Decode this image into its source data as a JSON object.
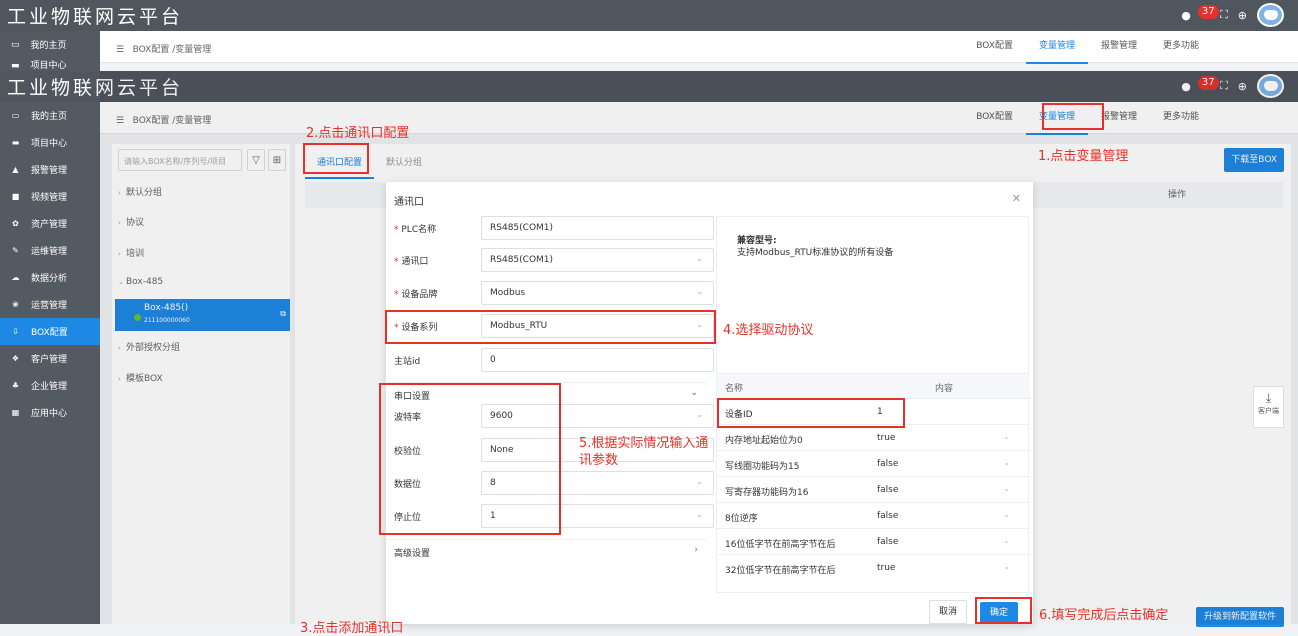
{
  "app": {
    "title": "工业物联网云平台",
    "notification_count": "37"
  },
  "breadcrumb": "BOX配置 /变量管理",
  "nav_tabs": [
    "BOX配置",
    "变量管理",
    "报警管理",
    "更多功能"
  ],
  "sidebar": [
    {
      "icon": "monitor-icon",
      "glyph": "▭",
      "label": "我的主页"
    },
    {
      "icon": "project-icon",
      "glyph": "▬",
      "label": "项目中心"
    },
    {
      "icon": "bell-icon",
      "glyph": "▲",
      "label": "报警管理"
    },
    {
      "icon": "video-icon",
      "glyph": "■",
      "label": "视频管理"
    },
    {
      "icon": "asset-icon",
      "glyph": "✿",
      "label": "资产管理"
    },
    {
      "icon": "wrench-icon",
      "glyph": "✎",
      "label": "运维管理"
    },
    {
      "icon": "cloud-icon",
      "glyph": "☁",
      "label": "数据分析"
    },
    {
      "icon": "ops-icon",
      "glyph": "❀",
      "label": "运营管理"
    },
    {
      "icon": "box-config-icon",
      "glyph": "⇩",
      "label": "BOX配置"
    },
    {
      "icon": "customer-icon",
      "glyph": "❖",
      "label": "客户管理"
    },
    {
      "icon": "org-icon",
      "glyph": "♣",
      "label": "企业管理"
    },
    {
      "icon": "app-icon",
      "glyph": "▦",
      "label": "应用中心"
    }
  ],
  "sidebar_partial_label": "项目中心",
  "left_panel": {
    "search_placeholder": "请输入BOX名称/序列号/项目",
    "groups": [
      "默认分组",
      "协议",
      "培训",
      "Box-485",
      "外部授权分组",
      "模板BOX"
    ],
    "selected_box": {
      "name": "Box-485()",
      "serial": "211100000060"
    }
  },
  "sub_tabs": [
    "通讯口配置",
    "默认分组"
  ],
  "download_button": "下载至BOX",
  "table_header_action": "操作",
  "upgrade_button": "升级到新配置软件",
  "dialog": {
    "title": "通讯口",
    "fields": {
      "plc_name_label": "PLC名称",
      "plc_name_value": "RS485(COM1)",
      "port_label": "通讯口",
      "port_value": "RS485(COM1)",
      "brand_label": "设备品牌",
      "brand_value": "Modbus",
      "series_label": "设备系列",
      "series_value": "Modbus_RTU",
      "station_label": "主站id",
      "station_value": "0"
    },
    "serial_section": "串口设置",
    "serial": {
      "baud_label": "波特率",
      "baud_value": "9600",
      "parity_label": "校验位",
      "parity_value": "None",
      "databits_label": "数据位",
      "databits_value": "8",
      "stopbits_label": "停止位",
      "stopbits_value": "1"
    },
    "advanced_section": "高级设置",
    "compat_title": "兼容型号:",
    "compat_desc": "支持Modbus_RTU标准协议的所有设备",
    "param_table": {
      "header_name": "名称",
      "header_content": "内容",
      "rows": [
        {
          "name": "设备ID",
          "value": "1",
          "dropdown": false
        },
        {
          "name": "内存地址起始位为0",
          "value": "true",
          "dropdown": true
        },
        {
          "name": "写线圈功能码为15",
          "value": "false",
          "dropdown": true
        },
        {
          "name": "写寄存器功能码为16",
          "value": "false",
          "dropdown": true
        },
        {
          "name": "8位逆序",
          "value": "false",
          "dropdown": true
        },
        {
          "name": "16位低字节在前高字节在后",
          "value": "false",
          "dropdown": true
        },
        {
          "name": "32位低字节在前高字节在后",
          "value": "true",
          "dropdown": true
        }
      ]
    },
    "cancel_button": "取消",
    "ok_button": "确定"
  },
  "float_button": "客户端",
  "annotations": {
    "step1": "1.点击变量管理",
    "step2": "2.点击通讯口配置",
    "step3": "3.点击添加通讯口",
    "step4": "4.选择驱动协议",
    "step5": "5.根据实际情况输入通讯参数",
    "step6": "6.填写完成后点击确定"
  }
}
